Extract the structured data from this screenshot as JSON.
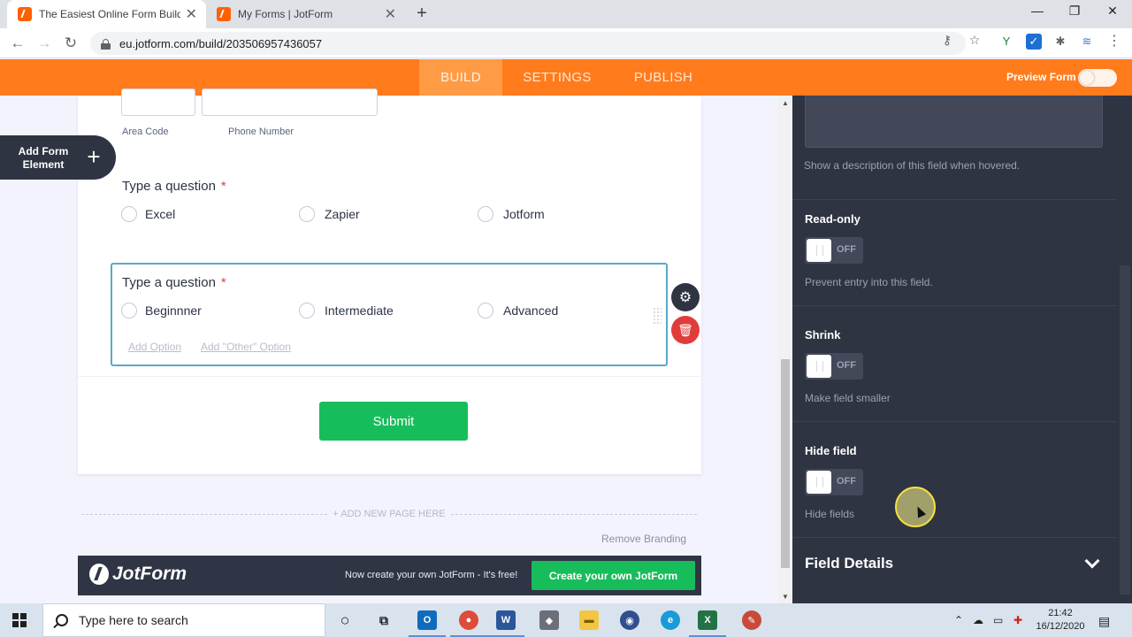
{
  "browser": {
    "tabs": [
      {
        "label": "The Easiest Online Form Builder |"
      },
      {
        "label": "My Forms | JotForm"
      }
    ],
    "url": "eu.jotform.com/build/203506957436057"
  },
  "jotform": {
    "nav": [
      {
        "label": "BUILD"
      },
      {
        "label": "SETTINGS"
      },
      {
        "label": "PUBLISH"
      }
    ],
    "preview_label": "Preview Form",
    "add_element": {
      "label": "Add Form Element",
      "icon": "plus-icon"
    }
  },
  "form": {
    "phone": {
      "area_code_label": "Area Code",
      "phone_number_label": "Phone Number"
    },
    "questions": [
      {
        "label": "Type a question",
        "required_mark": "*",
        "options": [
          "Excel",
          "Zapier",
          "Jotform"
        ]
      },
      {
        "label": "Type a question",
        "required_mark": "*",
        "options": [
          "Beginnner",
          "Intermediate",
          "Advanced"
        ]
      }
    ],
    "add_option": "Add Option",
    "add_other_option": "Add \"Other\" Option",
    "submit_label": "Submit",
    "add_new_page": "+ ADD NEW PAGE HERE",
    "remove_branding": "Remove Branding",
    "branding": {
      "logo_text": "JotForm",
      "tagline": "Now create your own JotForm - It's free!",
      "cta": "Create your own JotForm"
    }
  },
  "panel": {
    "hover_text_hint": "Show a description of this field when hovered.",
    "properties": [
      {
        "title": "Read-only",
        "state": "OFF",
        "hint": "Prevent entry into this field."
      },
      {
        "title": "Shrink",
        "state": "OFF",
        "hint": "Make field smaller"
      },
      {
        "title": "Hide field",
        "state": "OFF",
        "hint": "Hide fields"
      }
    ],
    "section": "Field Details"
  },
  "taskbar": {
    "search_placeholder": "Type here to search",
    "time": "21:42",
    "date": "16/12/2020"
  },
  "colors": {
    "jotform_orange": "#ff7b1c",
    "panel_bg": "#2f3442",
    "submit_green": "#18bd5b",
    "required_red": "#f23a3c",
    "selected_border": "#5aaac6"
  }
}
